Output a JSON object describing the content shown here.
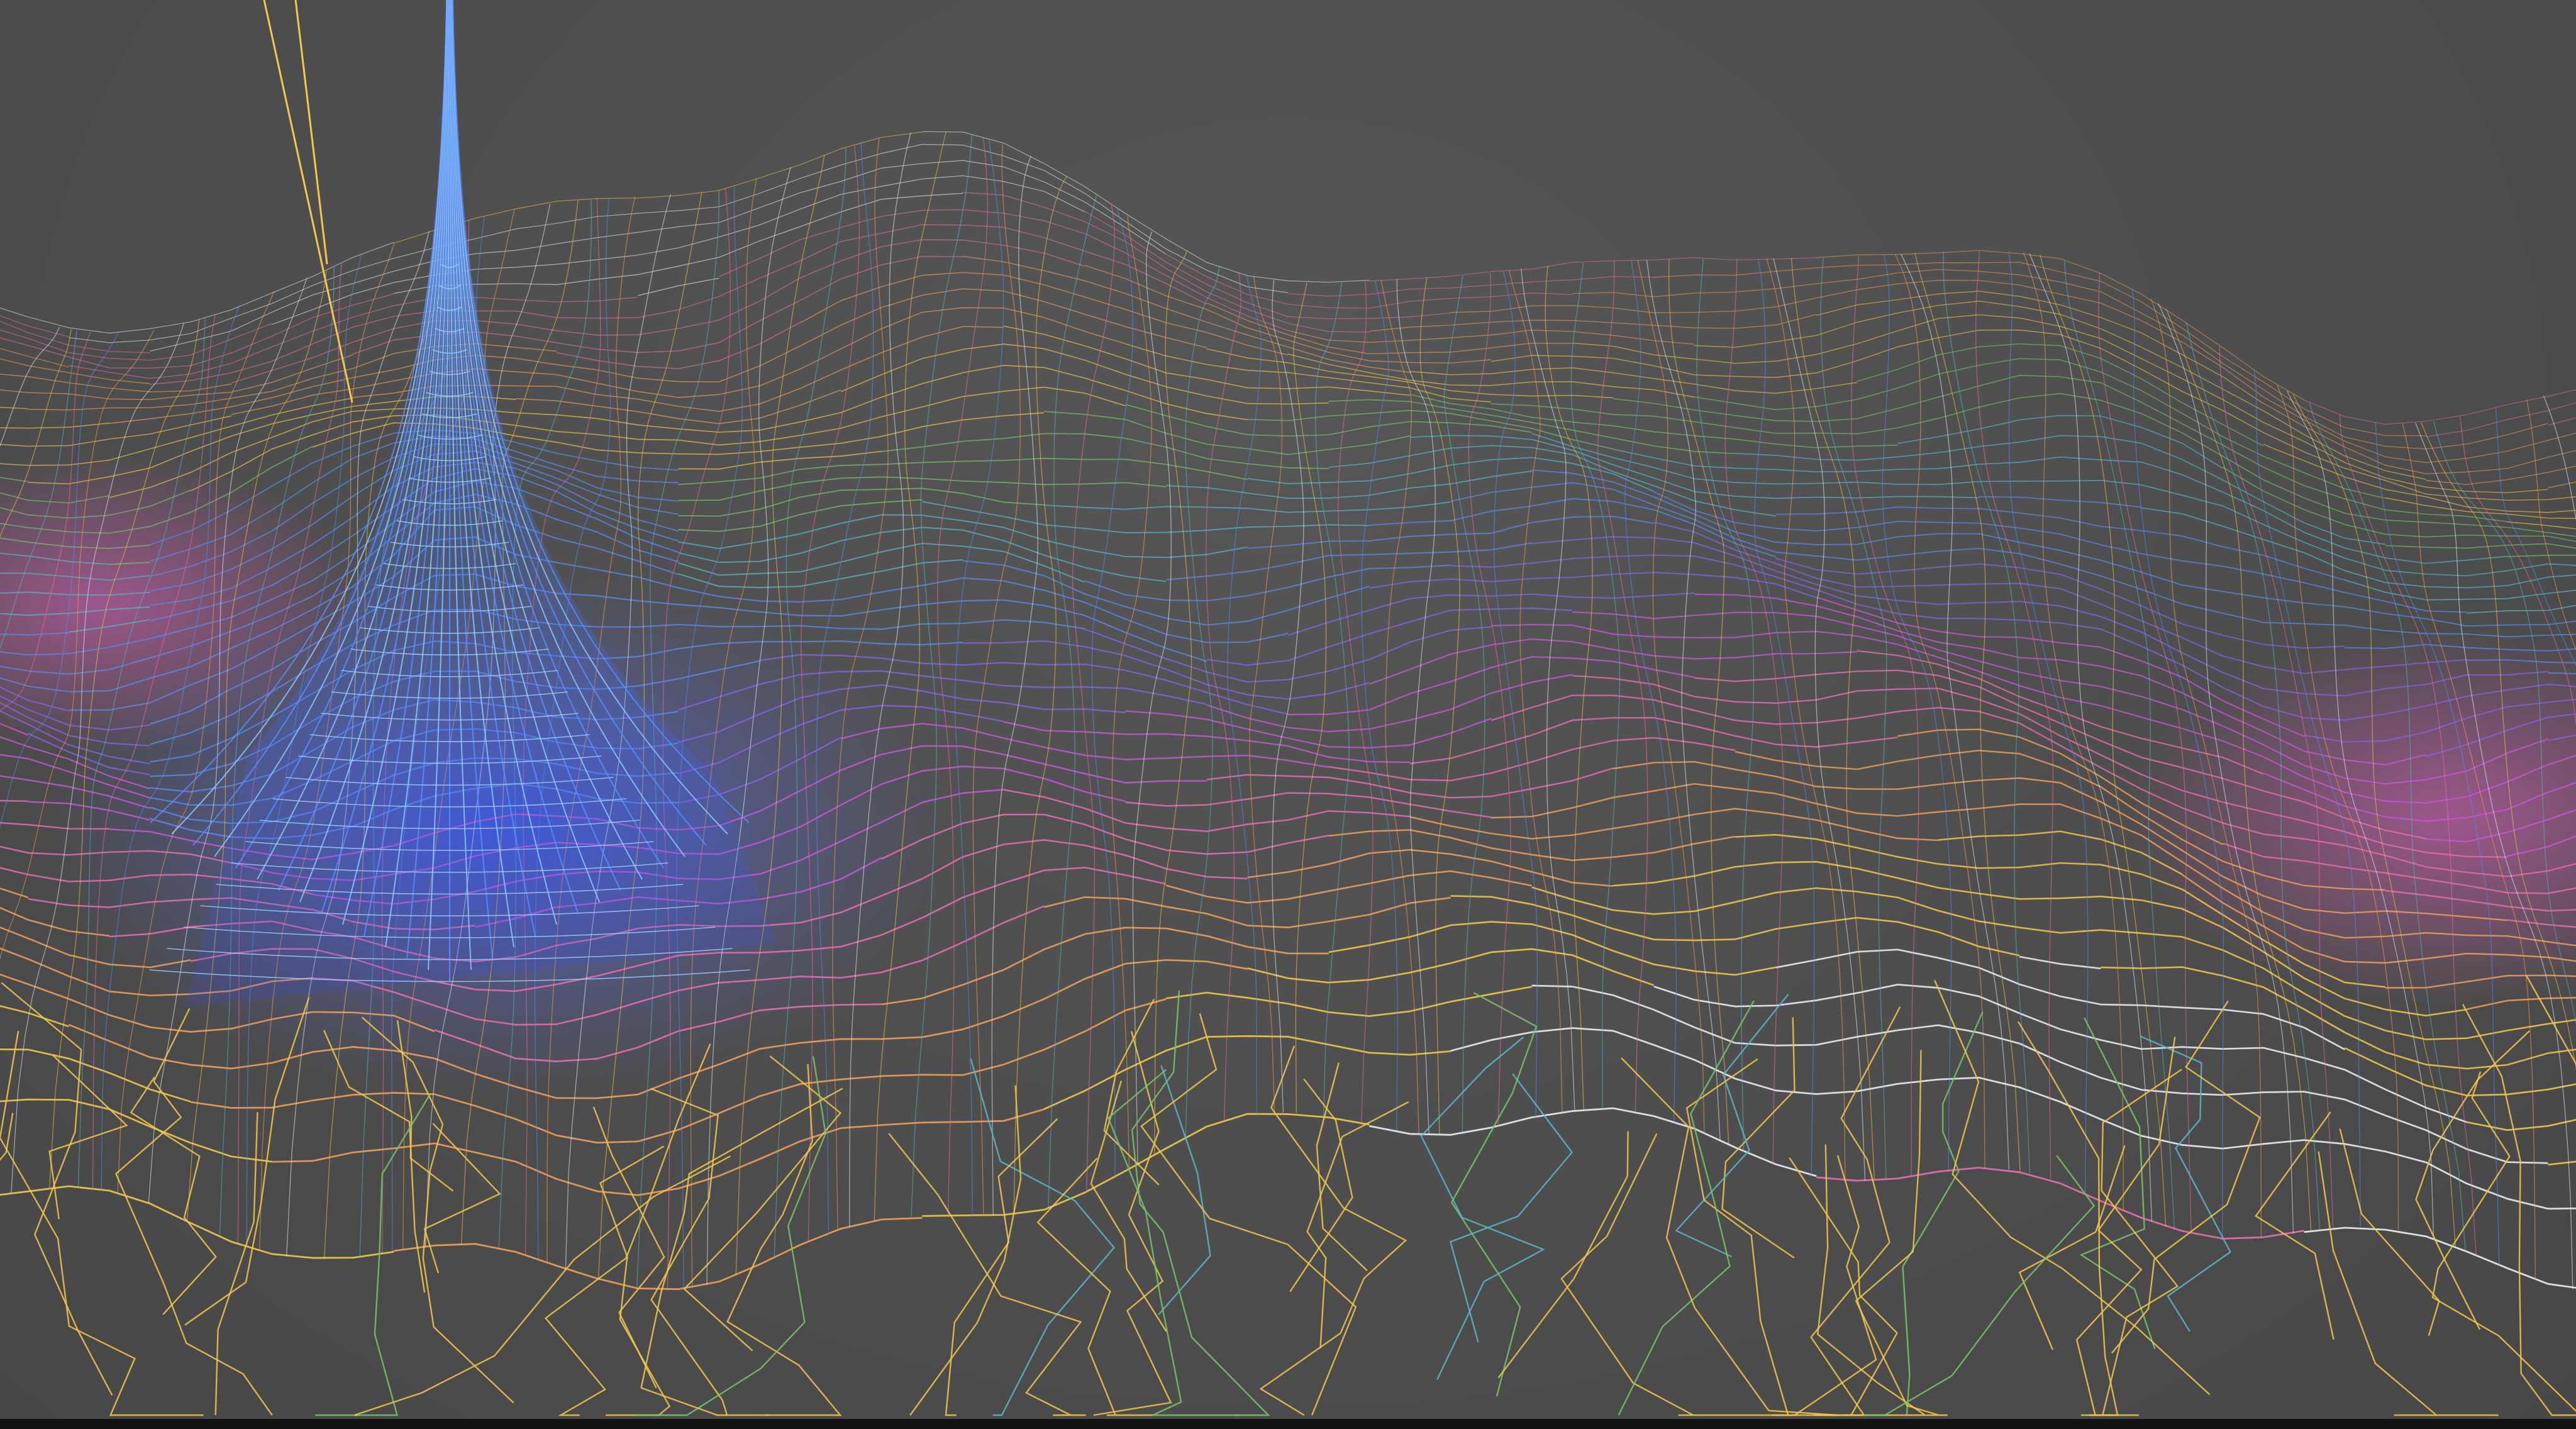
{
  "scene": {
    "subject": "wireframe-mesh-landscape",
    "background_color": "#4d4d4d",
    "palette": {
      "spike": "#4a8dff",
      "spike_core": "#3a5cff",
      "yellow": "#f2c84b",
      "orange": "#f0a05a",
      "pink": "#e86fb0",
      "magenta": "#c85ad8",
      "violet": "#8a63e8",
      "blue": "#5b8cf0",
      "teal": "#58b8c8",
      "green": "#79c46a",
      "white": "#e8eef5"
    },
    "bottom_bar_color": "#111111"
  }
}
